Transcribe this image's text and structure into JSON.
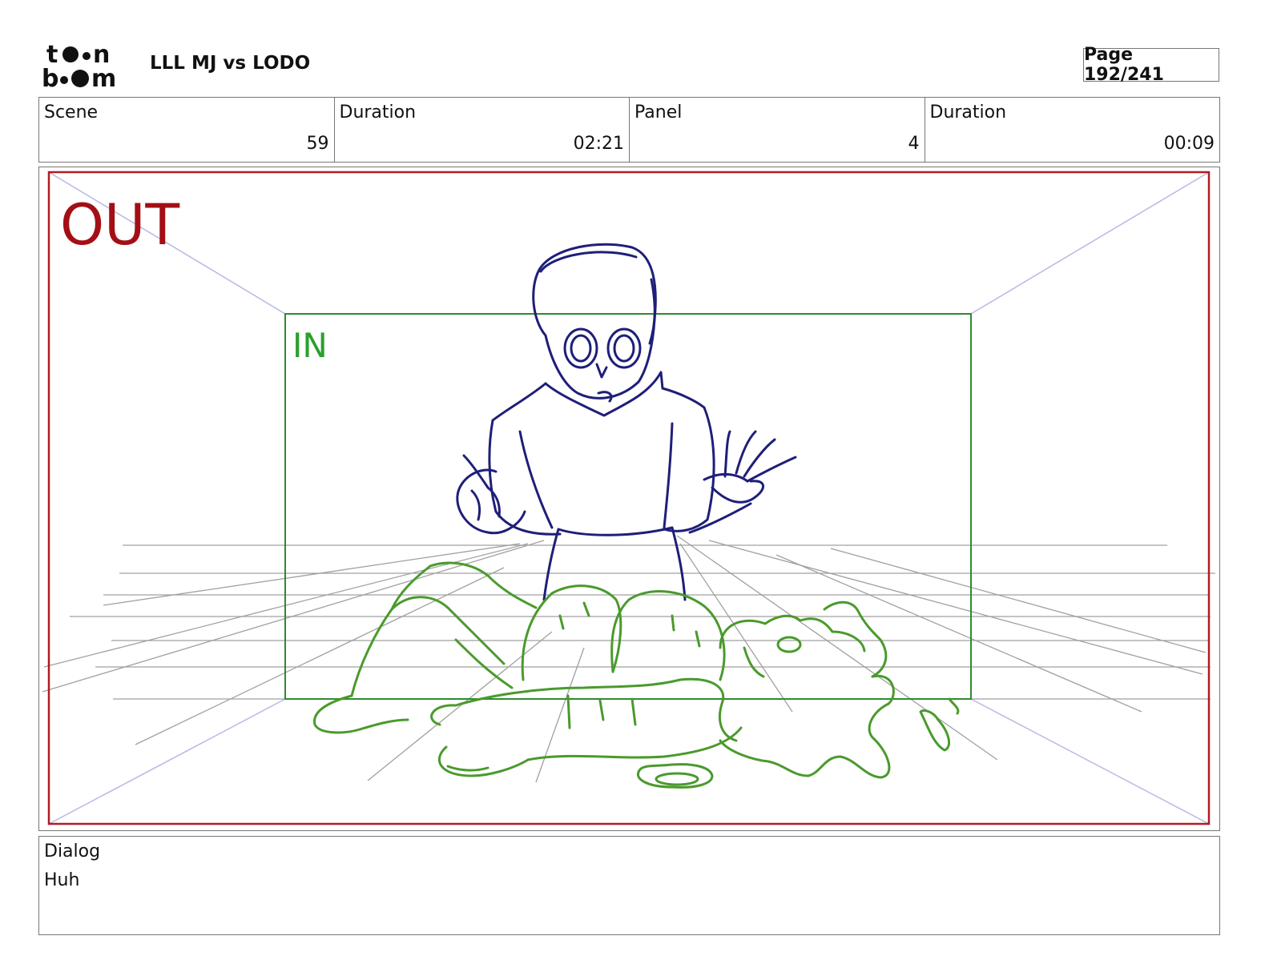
{
  "header": {
    "logo_text": "toon boom",
    "project_title": "LLL MJ vs LODO",
    "page_label": "Page 192/241"
  },
  "info": [
    {
      "label": "Scene",
      "value": "59"
    },
    {
      "label": "Duration",
      "value": "02:21"
    },
    {
      "label": "Panel",
      "value": "4"
    },
    {
      "label": "Duration",
      "value": "00:09"
    }
  ],
  "panel": {
    "out_label": "OUT",
    "in_label": "IN",
    "colors": {
      "out_frame": "#b01c22",
      "in_frame": "#2e8b2e",
      "character_blue": "#1e1f78",
      "character_green": "#4a9a2c",
      "perspective": "#b8b8e6",
      "floor_lines": "#9a9a9a"
    }
  },
  "dialog": {
    "label": "Dialog",
    "text": "Huh"
  }
}
